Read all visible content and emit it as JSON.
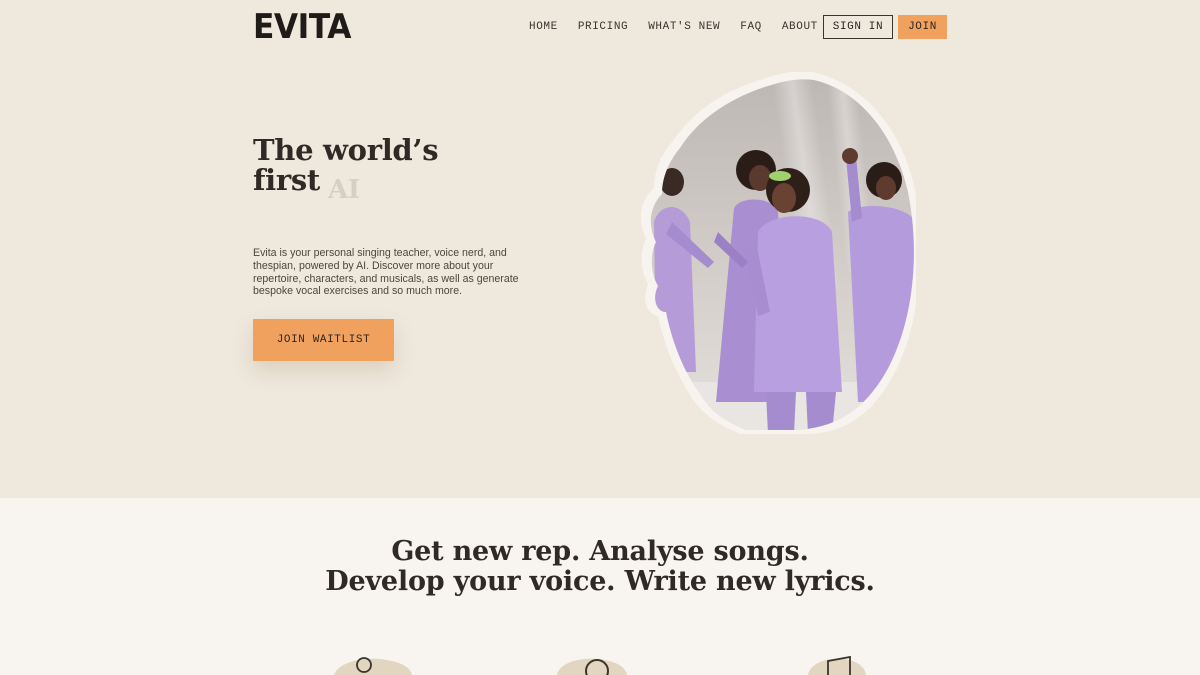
{
  "header": {
    "logo": "EVITA",
    "nav": [
      "HOME",
      "PRICING",
      "WHAT'S NEW",
      "FAQ",
      "ABOUT"
    ],
    "sign_in": "SIGN IN",
    "join": "JOIN"
  },
  "hero": {
    "title_line1": "The world’s",
    "title_line2": "first",
    "title_rotating": "AI",
    "description": "Evita is your personal singing teacher, voice nerd, and thespian, powered by AI. Discover more about your repertoire, characters, and musicals, as well as generate bespoke vocal exercises and so much more.",
    "cta": "JOIN WAITLIST"
  },
  "section2": {
    "heading_line1": "Get new rep. Analyse songs.",
    "heading_line2": "Develop your voice. Write new lyrics."
  },
  "icons": [
    "person-icon",
    "magnifier-icon",
    "music-note-icon"
  ],
  "colors": {
    "background": "#efe8dd",
    "section_background": "#f8f4ef",
    "accent": "#f0a15e",
    "text": "#2b2621",
    "lavender": "#a58ccf"
  }
}
